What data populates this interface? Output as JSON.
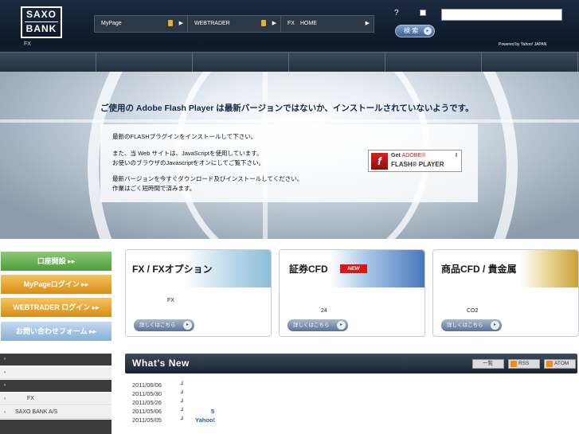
{
  "header": {
    "logo_top": "SAXO",
    "logo_bottom": "BANK",
    "logo_sub": "FX",
    "nav": [
      {
        "label": "MyPage",
        "locked": true
      },
      {
        "label": "WEBTRADER",
        "locked": true
      },
      {
        "label": "FX　HOME",
        "locked": false
      }
    ],
    "help": "?",
    "search_placeholder": "",
    "search_button": "検 索",
    "powered_by": "Powered by Yahoo! JAPAN"
  },
  "hero": {
    "title": "ご使用の Adobe Flash Player は最新バージョンではないか、インストールされていないようです。",
    "lines": [
      "最新のFLASHプラグインをインストールして下さい。",
      "また、当 Web サイトは、JavaScriptを使用しています。",
      "お使いのブラウザのJavascriptをオンにしてご覧下さい。",
      "最新バージョンを今すぐダウンロード及びインストールしてください。",
      "作業はごく短時間で済みます。"
    ],
    "get_flash": {
      "line1_prefix": "Get ",
      "line1_brand": "ADOBE®",
      "line2": "FLASH® PLAYER"
    }
  },
  "left": {
    "buttons": [
      {
        "label": "口座開設 ▸▸",
        "color": "green"
      },
      {
        "label": "MyPageログイン ▸▸",
        "color": "orange"
      },
      {
        "label": "WEBTRADER ログイン ▸▸",
        "color": "orange"
      },
      {
        "label": "お問い合わせフォーム ▸▸",
        "color": "lblue"
      }
    ],
    "menu": [
      {
        "type": "head",
        "chev": "›",
        "text": ""
      },
      {
        "type": "item",
        "chev": "›",
        "text": ""
      },
      {
        "type": "head",
        "chev": "›",
        "text": ""
      },
      {
        "type": "item",
        "chev": "›",
        "text": "FX"
      },
      {
        "type": "item",
        "chev": "›",
        "text": "SAXO BANK A/S"
      },
      {
        "type": "head",
        "chev": "",
        "text": ""
      }
    ]
  },
  "cards": [
    {
      "title": "FX / FXオプション",
      "sub": "FX",
      "more": "詳しくはこちら",
      "new": ""
    },
    {
      "title": "証券CFD",
      "sub": "24",
      "more": "詳しくはこちら",
      "new": "NEW"
    },
    {
      "title": "商品CFD / 貴金属",
      "sub": "CO2",
      "more": "詳しくはこちら",
      "new": ""
    }
  ],
  "whats_new": {
    "title": "What's New",
    "buttons": [
      "一覧",
      "RSS",
      "ATOM"
    ],
    "items": [
      {
        "date": "2011/06/06",
        "sep": "┛",
        "link": ""
      },
      {
        "date": "2011/05/30",
        "sep": "┛",
        "link": ""
      },
      {
        "date": "2011/05/26",
        "sep": "┛",
        "link": ""
      },
      {
        "date": "2011/05/06",
        "sep": "┛",
        "link": "5"
      },
      {
        "date": "2011/05/05",
        "sep": "┛",
        "link": "Yahoo!"
      }
    ]
  },
  "colors": {
    "header_bg": "#0e1828",
    "accent_blue": "#1f5aa8",
    "green_button": "#4e9c38",
    "orange_button": "#d88c14"
  }
}
